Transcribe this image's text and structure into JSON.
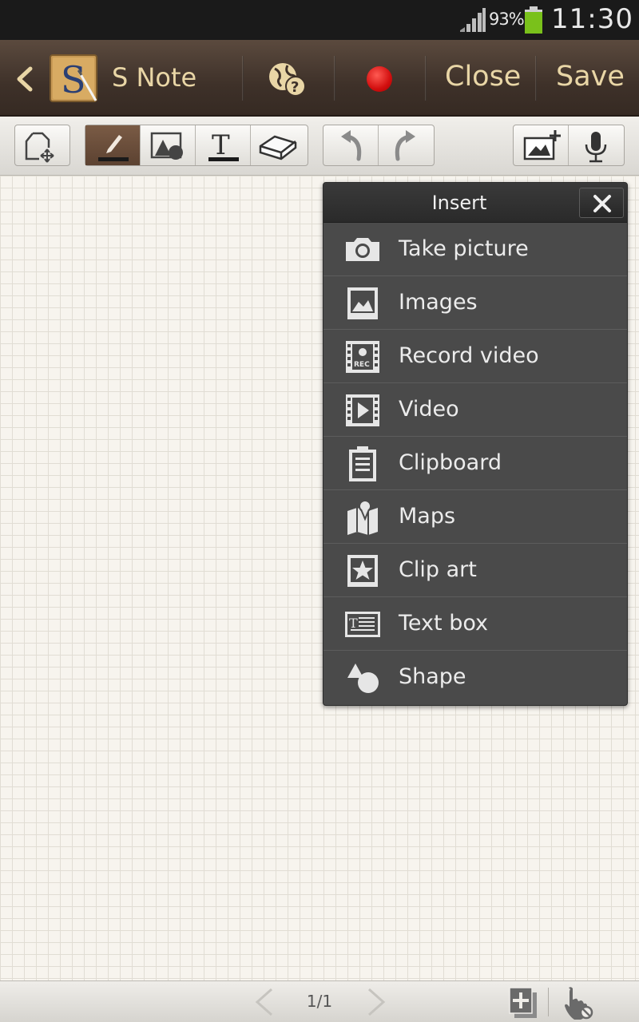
{
  "status_bar": {
    "battery_percent": "93%",
    "time": "11:30",
    "battery_color": "#7ac11b",
    "icons": [
      "signal-icon",
      "battery-icon"
    ]
  },
  "action_bar": {
    "back_icon": "back-chevron-icon",
    "app_icon": "s-note-app-icon",
    "title": "S Note",
    "help_icon": "globe-help-icon",
    "record_icon": "record-icon",
    "record_color": "#d20f0f",
    "close_label": "Close",
    "save_label": "Save",
    "text_color": "#e9d6a6"
  },
  "toolbar": {
    "tools": [
      {
        "name": "page-move",
        "icon": "page-move-icon"
      },
      {
        "name": "pen",
        "icon": "pen-icon",
        "active": true
      },
      {
        "name": "shape",
        "icon": "shape-icon"
      },
      {
        "name": "text",
        "icon": "text-icon"
      },
      {
        "name": "eraser",
        "icon": "eraser-icon"
      },
      {
        "name": "undo",
        "icon": "undo-icon"
      },
      {
        "name": "redo",
        "icon": "redo-icon"
      },
      {
        "name": "insert-image",
        "icon": "insert-image-icon"
      },
      {
        "name": "voice",
        "icon": "microphone-icon"
      }
    ]
  },
  "insert_popup": {
    "title": "Insert",
    "close_icon": "close-icon",
    "items": [
      {
        "label": "Take picture",
        "icon": "camera-icon"
      },
      {
        "label": "Images",
        "icon": "image-icon"
      },
      {
        "label": "Record video",
        "icon": "record-video-icon"
      },
      {
        "label": "Video",
        "icon": "video-icon"
      },
      {
        "label": "Clipboard",
        "icon": "clipboard-icon"
      },
      {
        "label": "Maps",
        "icon": "map-icon"
      },
      {
        "label": "Clip art",
        "icon": "clip-art-icon"
      },
      {
        "label": "Text box",
        "icon": "text-box-icon"
      },
      {
        "label": "Shape",
        "icon": "shape-icon"
      }
    ]
  },
  "bottom_bar": {
    "page_indicator": "1/1",
    "prev_icon": "prev-page-icon",
    "next_icon": "next-page-icon",
    "add_page_icon": "add-page-icon",
    "hand_icon": "hand-mode-icon"
  }
}
